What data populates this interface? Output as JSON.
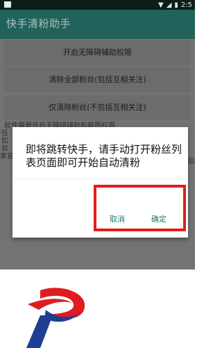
{
  "status_bar": {
    "time": "2:5",
    "icons": [
      "wifi-icon",
      "signal-icon",
      "battery-icon"
    ]
  },
  "app_bar": {
    "title": "快手清粉助手"
  },
  "buttons": [
    {
      "label": "开启无障碍辅助权限"
    },
    {
      "label": "清除全部粉丝(包括互相关注)"
    },
    {
      "label": "仅清除粉丝(不包括互相关注)"
    }
  ],
  "hint_lines": [
    "软件需要开启无障碍辅助和截图权限",
    "任",
    "如",
    "软",
    "果自"
  ],
  "hint_tail": "后",
  "dialog": {
    "message": "即将跳转快手，请手动打开粉丝列表页面即可开始自动清粉",
    "cancel_label": "取消",
    "confirm_label": "确定"
  },
  "colors": {
    "appbar": "#21625a",
    "accent": "#1f7a6e",
    "highlight": "#e21d1d",
    "logo_red": "#e01b22",
    "logo_blue": "#1d3f93"
  }
}
